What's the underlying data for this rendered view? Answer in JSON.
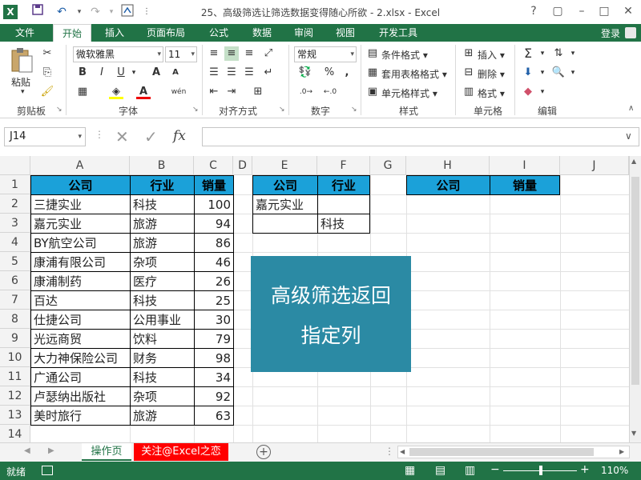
{
  "window": {
    "title": "25、高级筛选让筛选数据变得随心所欲 - 2.xlsx - Excel",
    "app_icon": "X",
    "controls": [
      "?",
      "▢",
      "–",
      "□",
      "✕"
    ]
  },
  "quick_access": [
    "save-icon",
    "undo-icon",
    "redo-icon",
    "touch-icon"
  ],
  "tabs": [
    "文件",
    "开始",
    "插入",
    "页面布局",
    "公式",
    "数据",
    "审阅",
    "视图",
    "开发工具"
  ],
  "active_tab": "开始",
  "login": "登录",
  "ribbon": {
    "clipboard": {
      "paste": "粘贴",
      "label": "剪贴板"
    },
    "font": {
      "name": "微软雅黑",
      "size": "11",
      "label": "字体",
      "bold": "B",
      "italic": "I",
      "underline": "U",
      "phonetic": "wén"
    },
    "alignment": {
      "label": "对齐方式"
    },
    "number": {
      "format": "常规",
      "label": "数字",
      "percent": "%",
      "comma": ","
    },
    "styles": {
      "conditional": "条件格式",
      "table": "套用表格格式",
      "cell": "单元格样式",
      "label": "样式"
    },
    "cells": {
      "insert": "插入",
      "delete": "删除",
      "format": "格式",
      "label": "单元格"
    },
    "editing": {
      "label": "编辑",
      "sigma": "Σ"
    }
  },
  "formula_bar": {
    "name_box": "J14",
    "fx": "fx",
    "value": ""
  },
  "columns": [
    "A",
    "B",
    "C",
    "D",
    "E",
    "F",
    "G",
    "H",
    "I",
    "J"
  ],
  "rows": [
    "1",
    "2",
    "3",
    "4",
    "5",
    "6",
    "7",
    "8",
    "9",
    "10",
    "11",
    "12",
    "13",
    "14"
  ],
  "table": {
    "headers": [
      "公司",
      "行业",
      "销量"
    ],
    "rows": [
      [
        "三捷实业",
        "科技",
        "100"
      ],
      [
        "嘉元实业",
        "旅游",
        "94"
      ],
      [
        "BY航空公司",
        "旅游",
        "86"
      ],
      [
        "康浦有限公司",
        "杂项",
        "46"
      ],
      [
        "康浦制药",
        "医疗",
        "26"
      ],
      [
        "百达",
        "科技",
        "25"
      ],
      [
        "仕捷公司",
        "公用事业",
        "30"
      ],
      [
        "光远商贸",
        "饮料",
        "79"
      ],
      [
        "大力神保险公司",
        "财务",
        "98"
      ],
      [
        "广通公司",
        "科技",
        "34"
      ],
      [
        "卢瑟纳出版社",
        "杂项",
        "92"
      ],
      [
        "美时旅行",
        "旅游",
        "63"
      ]
    ]
  },
  "criteria": {
    "headers": [
      "公司",
      "行业"
    ],
    "rows": [
      [
        "嘉元实业",
        ""
      ],
      [
        "",
        "科技"
      ]
    ]
  },
  "output": {
    "headers": [
      "公司",
      "销量"
    ]
  },
  "overlay": {
    "line1": "高级筛选返回",
    "line2": "指定列"
  },
  "sheets": {
    "active": "操作页",
    "other": "关注@Excel之恋"
  },
  "status": {
    "ready": "就绪",
    "zoom": "110%"
  },
  "colors": {
    "excel_green": "#217346",
    "header_fill": "#1ba1d9",
    "overlay": "#2b8aa4",
    "tab_red": "#ff0000"
  }
}
